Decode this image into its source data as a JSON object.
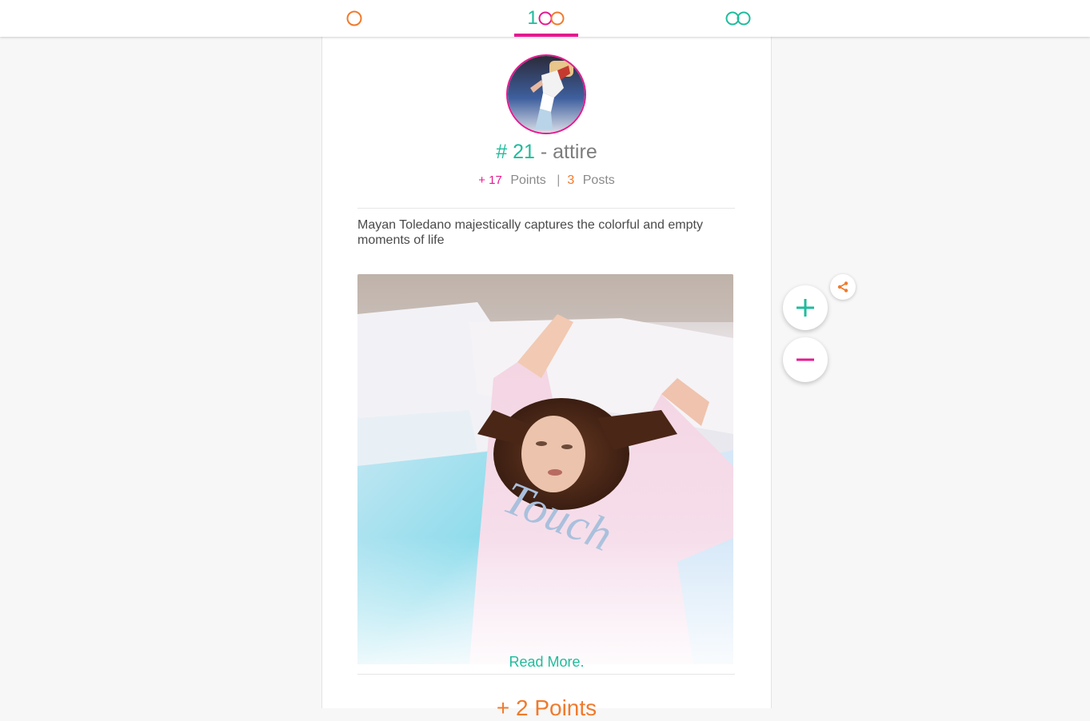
{
  "nav": {
    "tabs": [
      {
        "name": "circle",
        "active": false,
        "color": "#f07a2c"
      },
      {
        "label_digit": "1",
        "name": "top-100",
        "active": true,
        "color": "#e6198f"
      },
      {
        "name": "infinity",
        "active": false,
        "color": "#1fbc9c"
      }
    ]
  },
  "profile": {
    "rank": "# 21",
    "separator": " - ",
    "name": "attire",
    "points": "+ 17",
    "points_label": "Points",
    "stat_separator": "|",
    "posts": "3",
    "posts_label": "Posts"
  },
  "post": {
    "description": "Mayan Toledano majestically captures the colorful and empty moments of life",
    "photo_text": "Touch",
    "read_more": "Read More.",
    "points": "+ 2 Points"
  },
  "actions": {
    "plus_icon": "plus-icon",
    "minus_icon": "minus-icon",
    "share_icon": "share-icon"
  },
  "colors": {
    "accent_pink": "#e6198f",
    "accent_teal": "#1fbc9c",
    "accent_orange": "#f07a2c"
  }
}
